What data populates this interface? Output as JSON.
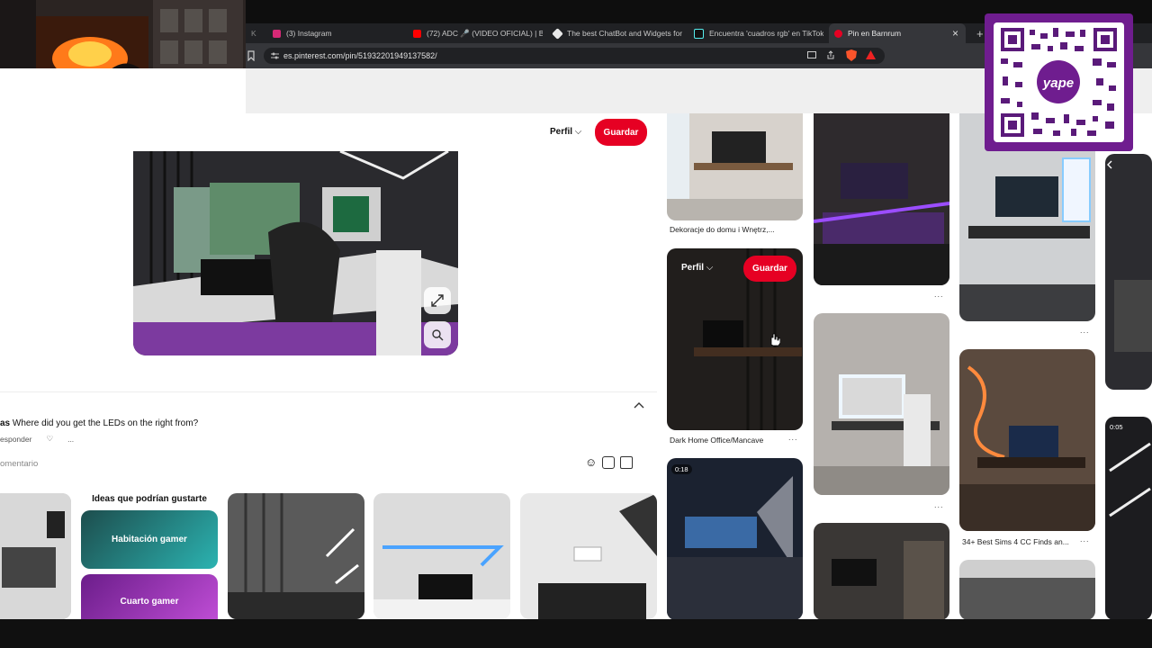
{
  "browser": {
    "tabs": [
      {
        "label": "(3) Instagram",
        "color": "#d62976"
      },
      {
        "label": "(72) ADC 🎤 (VIDEO OFICIAL) | BLESS",
        "color": "#ff0000"
      },
      {
        "label": "The best ChatBot and Widgets for K",
        "color": "#ffffff"
      },
      {
        "label": "Encuentra 'cuadros rgb' en TikTok | B",
        "color": "#111111"
      },
      {
        "label": "Pin en Barnrum",
        "color": "#e60023"
      }
    ],
    "close_glyph": "×",
    "newtab_glyph": "+",
    "url": "es.pinterest.com/pin/51932201949137582/"
  },
  "pin": {
    "perfil_label": "Perfil",
    "save_label": "Guardar",
    "comment_user": "as",
    "comment_text": "Where did you get the LEDs on the right from?",
    "reply_label": "esponder",
    "comment_placeholder": "omentario",
    "ideas_title": "Ideas que podrían gustarte",
    "idea_1": "Habitación gamer",
    "idea_2": "Cuarto gamer"
  },
  "feed": {
    "caption_1": "Dekoracje do domu i Wnętrz,...",
    "caption_2": "Dark Home Office/Mancave",
    "caption_3": "34+ Best Sims 4 CC Finds an...",
    "hover_perfil": "Perfil",
    "hover_save": "Guardar",
    "video_time_1": "0:18",
    "video_time_2": "0:05",
    "dots": "..."
  },
  "qr": {
    "brand": "yape"
  },
  "colors": {
    "accent": "#e60023",
    "qr_bg": "#6f1d8f"
  }
}
